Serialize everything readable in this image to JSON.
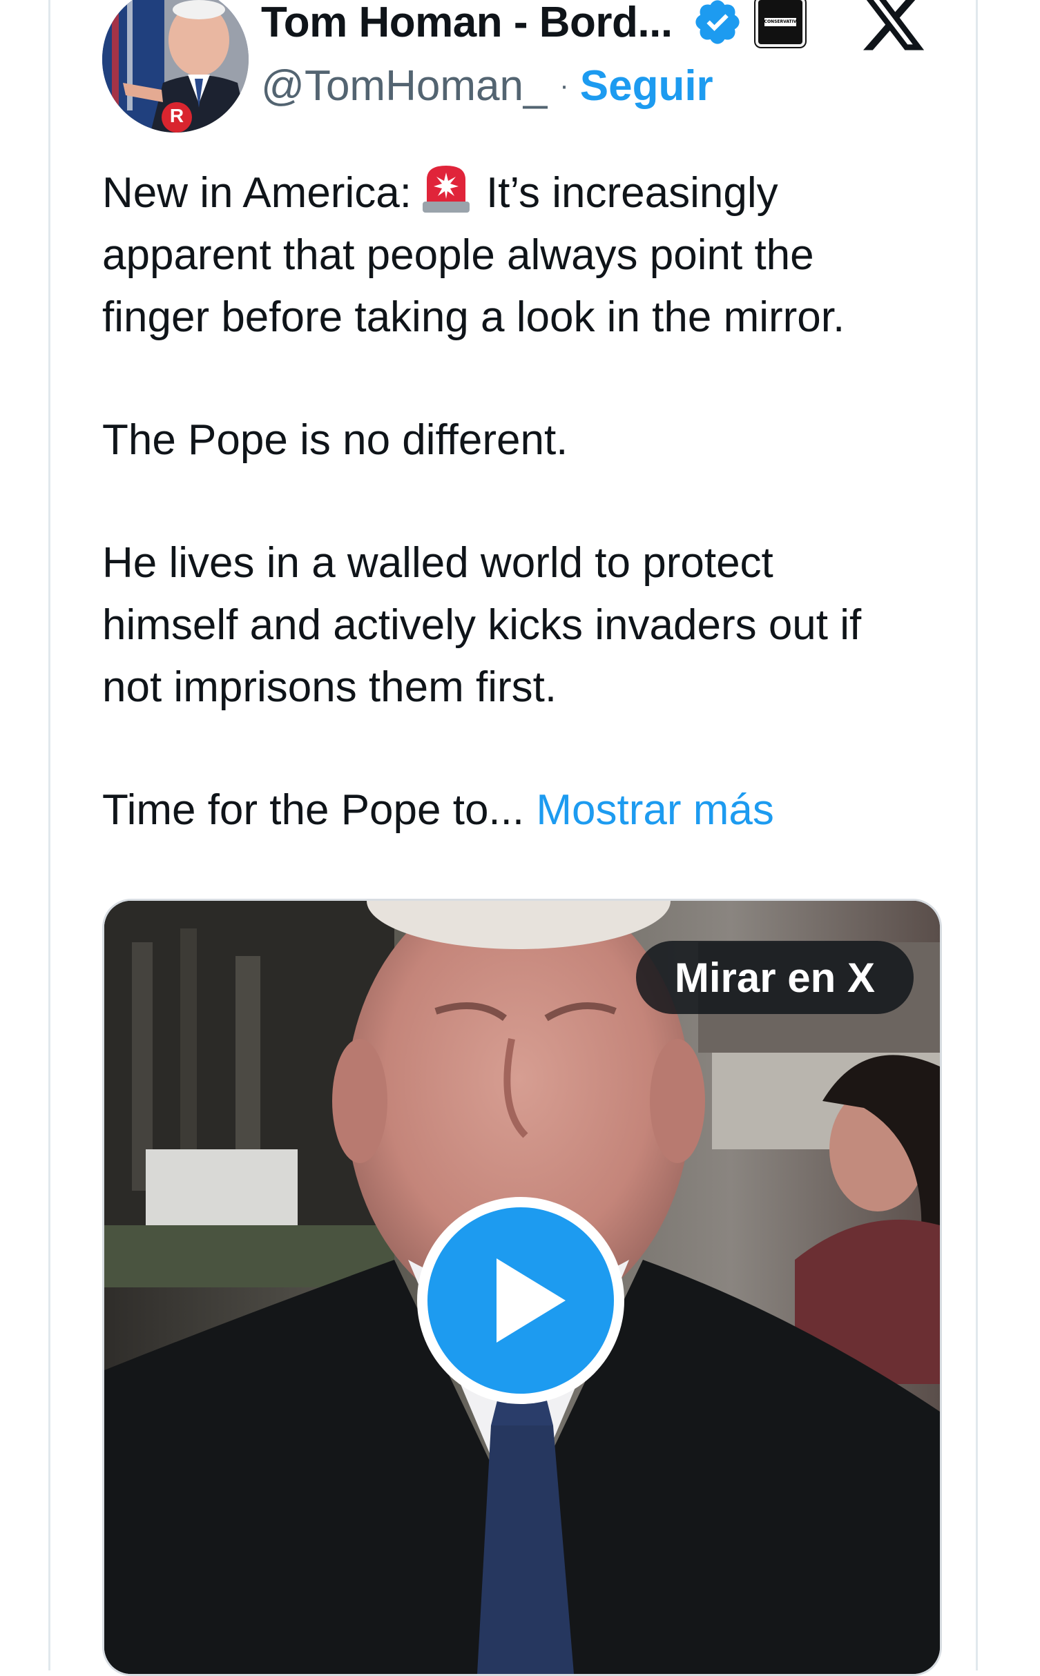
{
  "author": {
    "display_name": "Tom Homan - Bord...",
    "handle": "@TomHoman_",
    "separator": "·",
    "follow_label": "Seguir",
    "verified": true,
    "affiliation_badge_text": "CONSERVATIVE",
    "avatar_badge_letter": "R"
  },
  "platform_icon": "x-logo-icon",
  "tweet": {
    "line1_prefix": "New in America:",
    "line1_emoji": "rotating-light-icon",
    "line1_suffix": "It’s increasingly",
    "line2": "apparent that people always point the",
    "line3": "finger before taking a look in the mirror.",
    "para2": "The Pope is no different.",
    "para3_line1": "He lives in a walled world to protect",
    "para3_line2": "himself and actively kicks invaders out if",
    "para3_line3": "not imprisons them first.",
    "para4_text": "Time for the Pope to...",
    "show_more_label": "Mostrar más"
  },
  "media": {
    "watch_label": "Mirar en X",
    "play_icon": "play-icon"
  },
  "colors": {
    "accent": "#1d9bf0",
    "text": "#0f1419",
    "secondary": "#536471",
    "border": "#e1e8ed"
  }
}
